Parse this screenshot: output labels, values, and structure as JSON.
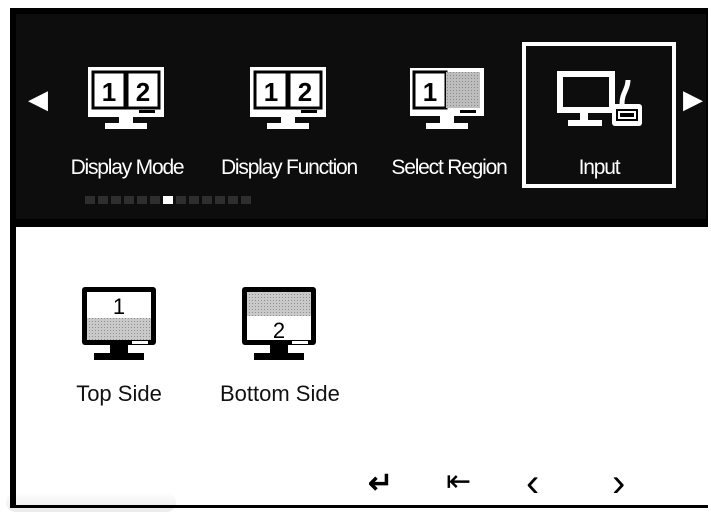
{
  "top_menu": {
    "left_arrow": "◀",
    "right_arrow": "▶",
    "items": [
      {
        "label": "Display Mode",
        "icon": "dual-monitor-12-icon",
        "nums": [
          "1",
          "2"
        ]
      },
      {
        "label": "Display Function",
        "icon": "dual-monitor-12-icon",
        "nums": [
          "1",
          "2"
        ]
      },
      {
        "label": "Select Region",
        "icon": "monitor-region-1-icon",
        "nums": [
          "1"
        ]
      },
      {
        "label": "Input",
        "icon": "computer-input-icon"
      }
    ],
    "selected_index": 3,
    "page_indicator": {
      "count": 13,
      "active_index": 6
    }
  },
  "submenu": {
    "items": [
      {
        "label": "Top Side",
        "icon": "monitor-top-side-icon",
        "num": "1"
      },
      {
        "label": "Bottom Side",
        "icon": "monitor-bottom-side-icon",
        "num": "2"
      }
    ]
  },
  "controls": {
    "enter": "↵",
    "exit": "⇤",
    "prev": "‹",
    "next": "›"
  },
  "colors": {
    "background": "#0d0d0d",
    "text_light": "#ffffff",
    "panel": "#ffffff",
    "text_dark": "#111111"
  }
}
